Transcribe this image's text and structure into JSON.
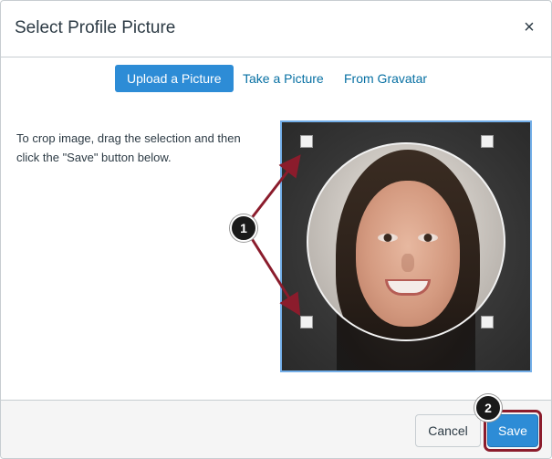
{
  "dialog": {
    "title": "Select Profile Picture",
    "close_icon": "×"
  },
  "tabs": [
    {
      "label": "Upload a Picture",
      "active": true
    },
    {
      "label": "Take a Picture",
      "active": false
    },
    {
      "label": "From Gravatar",
      "active": false
    }
  ],
  "instructions": "To crop image, drag the selection and then click the \"Save\" button below.",
  "callouts": {
    "one": "1",
    "two": "2"
  },
  "footer": {
    "cancel_label": "Cancel",
    "save_label": "Save"
  },
  "colors": {
    "primary": "#2d8cd6",
    "link": "#0770a3",
    "callout_accent": "#8b1c2c"
  }
}
